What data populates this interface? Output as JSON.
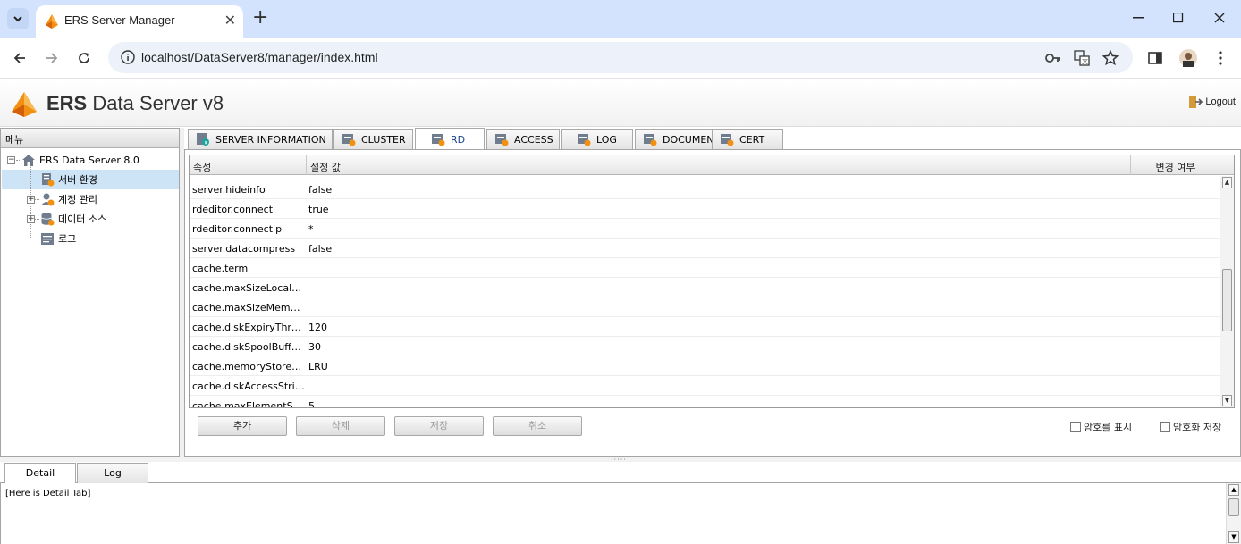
{
  "browser": {
    "tab_title": "ERS Server Manager",
    "url": "localhost/DataServer8/manager/index.html"
  },
  "header": {
    "title_bold": "ERS",
    "title_rest": "Data Server v8",
    "logout_label": "Logout"
  },
  "menu": {
    "title": "메뉴",
    "root": "ERS Data Server 8.0",
    "items": [
      {
        "label": "서버 환경",
        "icon": "server-settings-icon",
        "expandable": false
      },
      {
        "label": "계정 관리",
        "icon": "user-icon",
        "expandable": true
      },
      {
        "label": "데이터 소스",
        "icon": "database-icon",
        "expandable": true
      },
      {
        "label": "로그",
        "icon": "log-icon",
        "expandable": false
      }
    ]
  },
  "tabs": [
    {
      "label": "SERVER INFORMATION",
      "icon": "info-icon"
    },
    {
      "label": "CLUSTER",
      "icon": "cluster-icon"
    },
    {
      "label": "RD",
      "icon": "rd-icon",
      "active": true
    },
    {
      "label": "ACCESS",
      "icon": "access-icon"
    },
    {
      "label": "LOG",
      "icon": "log-icon"
    },
    {
      "label": "DOCUMEN",
      "icon": "document-icon"
    },
    {
      "label": "CERT",
      "icon": "cert-icon"
    }
  ],
  "grid": {
    "columns": [
      "속성",
      "설정 값",
      "변경 여부"
    ],
    "rows": [
      {
        "name": "server.hideinfo",
        "value": "false"
      },
      {
        "name": "rdeditor.connect",
        "value": "true"
      },
      {
        "name": "rdeditor.connectip",
        "value": "*"
      },
      {
        "name": "server.datacompress",
        "value": "false"
      },
      {
        "name": "cache.term",
        "value": ""
      },
      {
        "name": "cache.maxSizeLocalDi...",
        "value": ""
      },
      {
        "name": "cache.maxSizeMemory...",
        "value": ""
      },
      {
        "name": "cache.diskExpiryThrea...",
        "value": "120"
      },
      {
        "name": "cache.diskSpoolBuffer...",
        "value": "30"
      },
      {
        "name": "cache.memoryStoreEvi...",
        "value": "LRU"
      },
      {
        "name": "cache.diskAccessStripes",
        "value": ""
      },
      {
        "name": "cache.maxElementSize...",
        "value": "5"
      }
    ]
  },
  "actions": {
    "add": "추가",
    "delete": "삭제",
    "save": "저장",
    "cancel": "취소",
    "show_password": "암호를 표시",
    "save_encrypted": "암호화 저장"
  },
  "bottom": {
    "tabs": [
      "Detail",
      "Log"
    ],
    "detail_text": "[Here is Detail Tab]"
  }
}
